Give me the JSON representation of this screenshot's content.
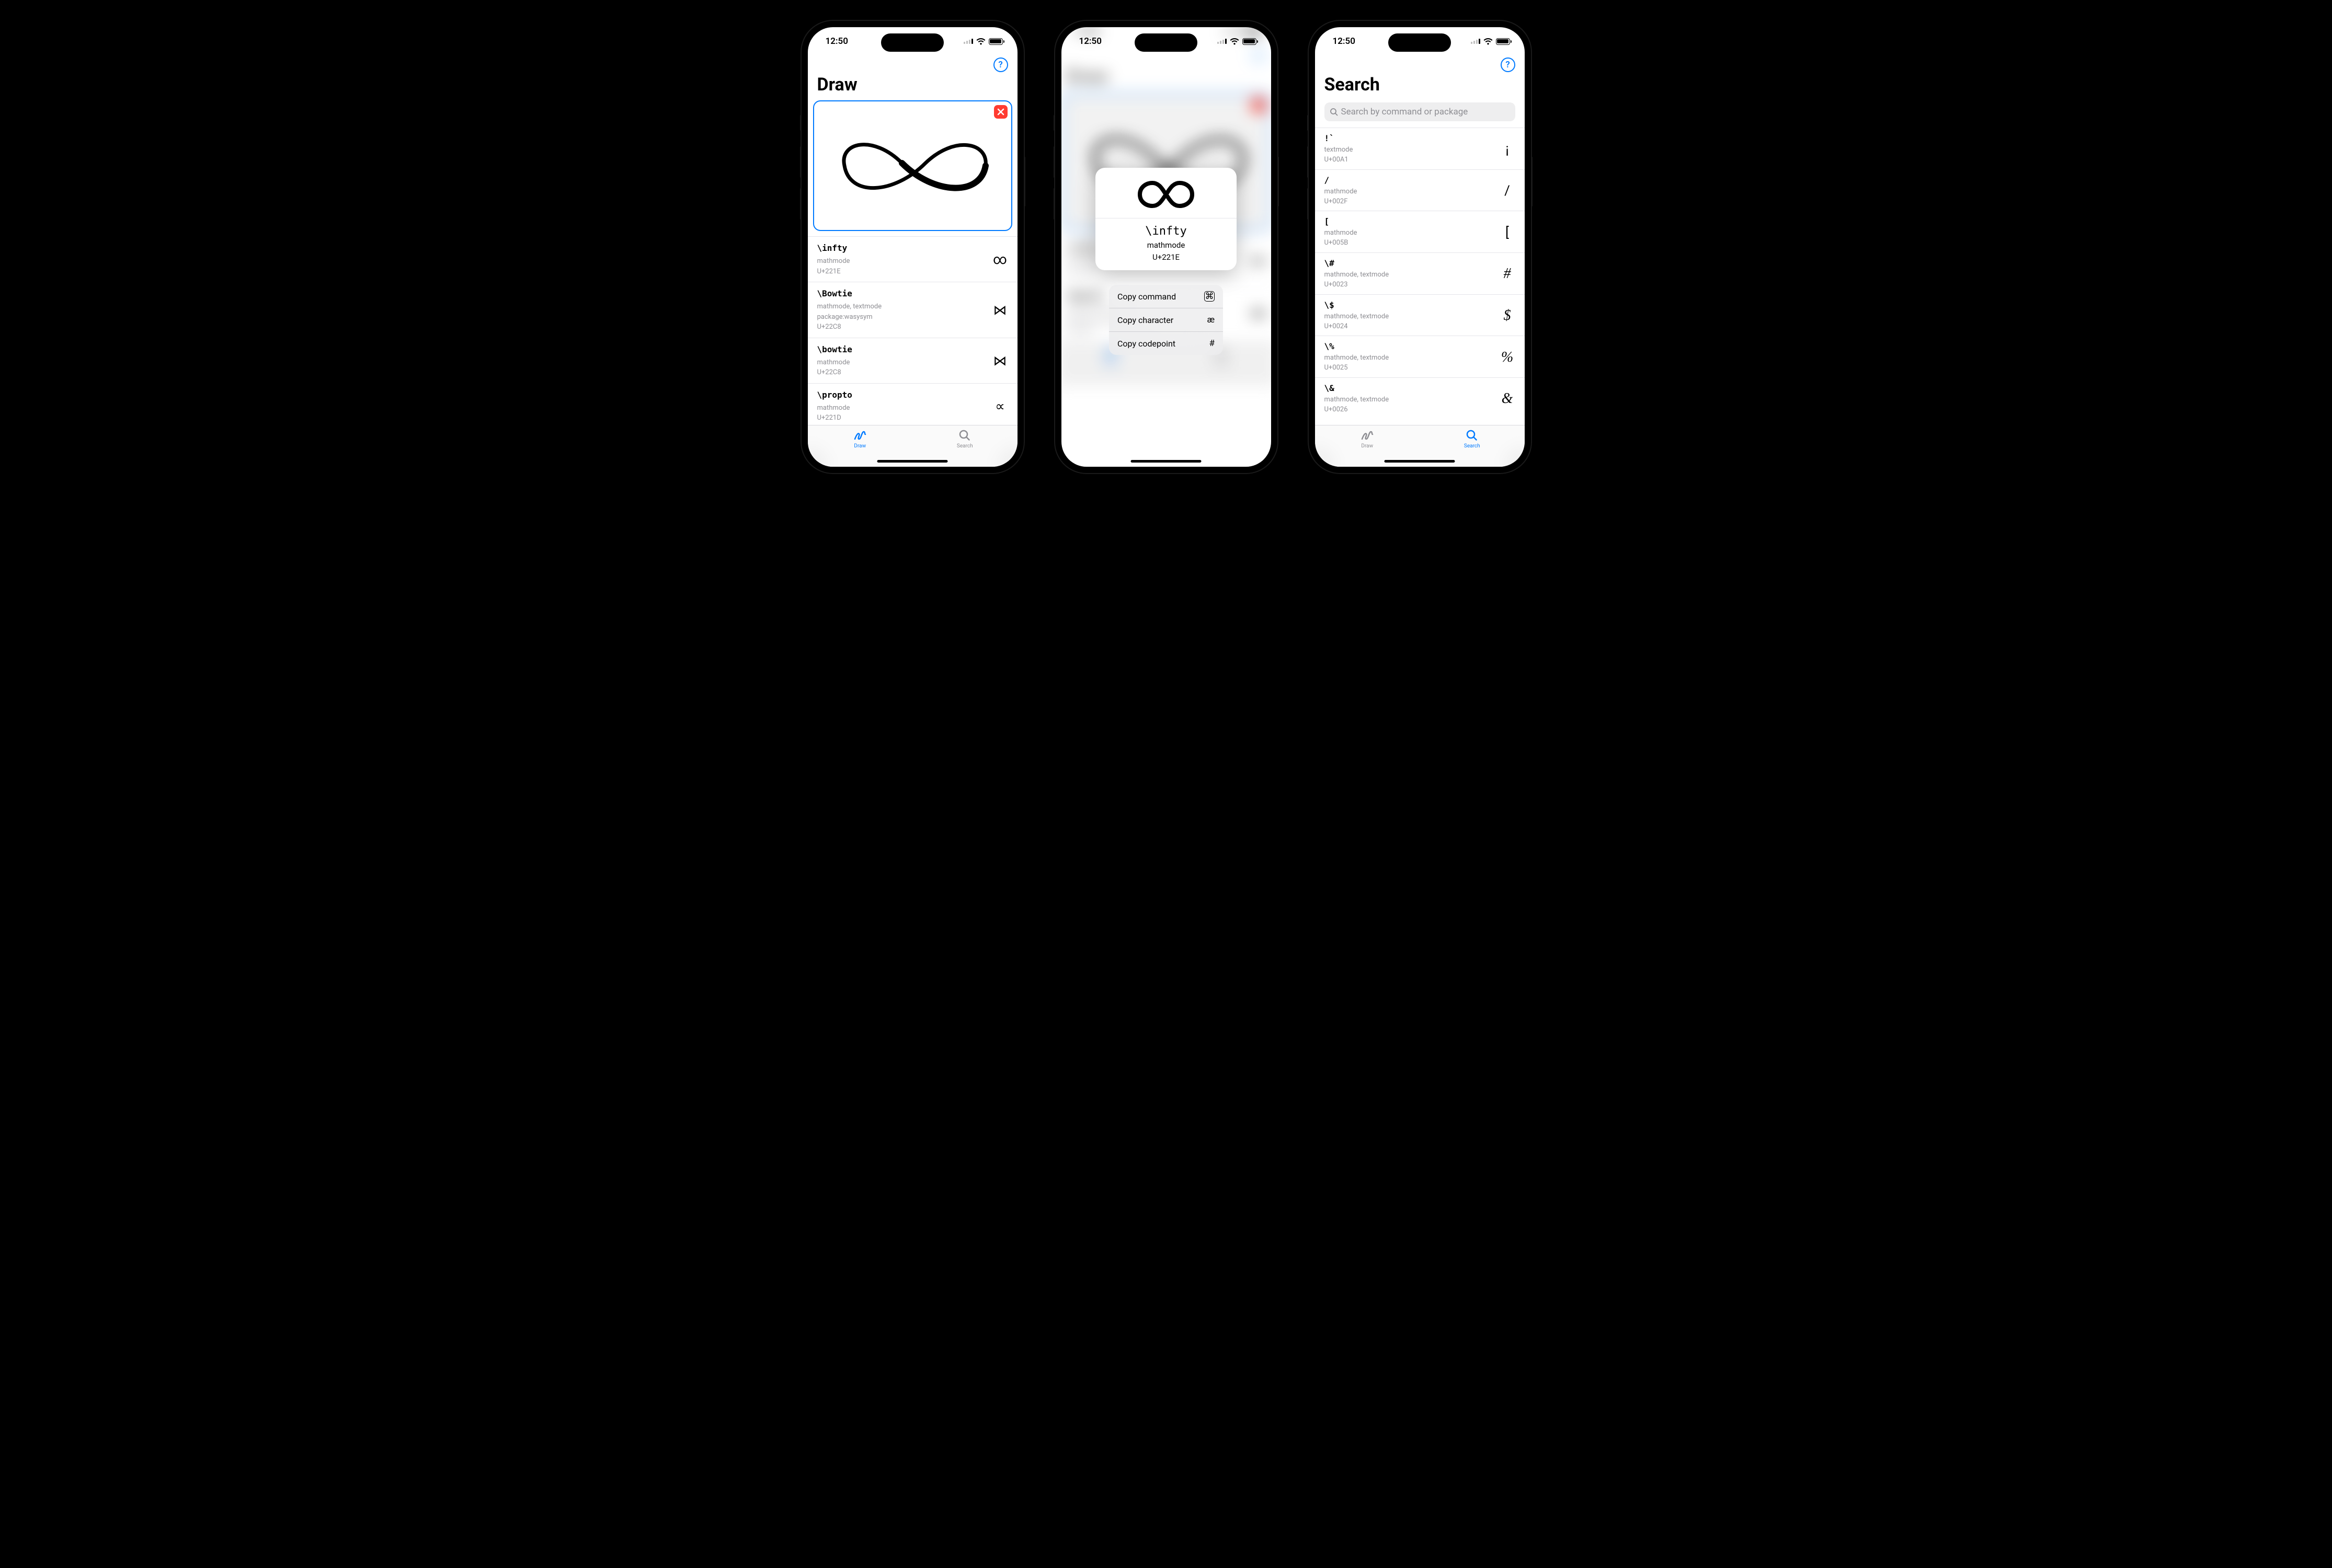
{
  "status_time": "12:50",
  "help_label": "?",
  "screens": {
    "draw": {
      "title": "Draw",
      "tabs": {
        "draw": "Draw",
        "search": "Search"
      },
      "results": [
        {
          "cmd": "\\infty",
          "meta": "mathmode\nU+221E",
          "glyph": "∞"
        },
        {
          "cmd": "\\Bowtie",
          "meta": "mathmode, textmode\npackage:wasysym\nU+22C8",
          "glyph": "⋈"
        },
        {
          "cmd": "\\bowtie",
          "meta": "mathmode\nU+22C8",
          "glyph": "⋈"
        },
        {
          "cmd": "\\propto",
          "meta": "mathmode\nU+221D",
          "glyph": "∝"
        }
      ]
    },
    "context": {
      "card": {
        "cmd": "\\infty",
        "mode": "mathmode",
        "code": "U+221E"
      },
      "menu": [
        {
          "label": "Copy command",
          "icon": "⌘"
        },
        {
          "label": "Copy character",
          "icon": "æ"
        },
        {
          "label": "Copy codepoint",
          "icon": "#"
        }
      ]
    },
    "search": {
      "title": "Search",
      "placeholder": "Search by command or package",
      "tabs": {
        "draw": "Draw",
        "search": "Search"
      },
      "results": [
        {
          "cmd": "!`",
          "meta": "textmode\nU+00A1",
          "glyph": "¡"
        },
        {
          "cmd": "/",
          "meta": "mathmode\nU+002F",
          "glyph": "/"
        },
        {
          "cmd": "[",
          "meta": "mathmode\nU+005B",
          "glyph": "["
        },
        {
          "cmd": "\\#",
          "meta": "mathmode, textmode\nU+0023",
          "glyph": "#"
        },
        {
          "cmd": "\\$",
          "meta": "mathmode, textmode\nU+0024",
          "glyph": "$"
        },
        {
          "cmd": "\\%",
          "meta": "mathmode, textmode\nU+0025",
          "glyph": "%"
        },
        {
          "cmd": "\\&",
          "meta": "mathmode, textmode\nU+0026",
          "glyph": "&"
        }
      ]
    }
  }
}
